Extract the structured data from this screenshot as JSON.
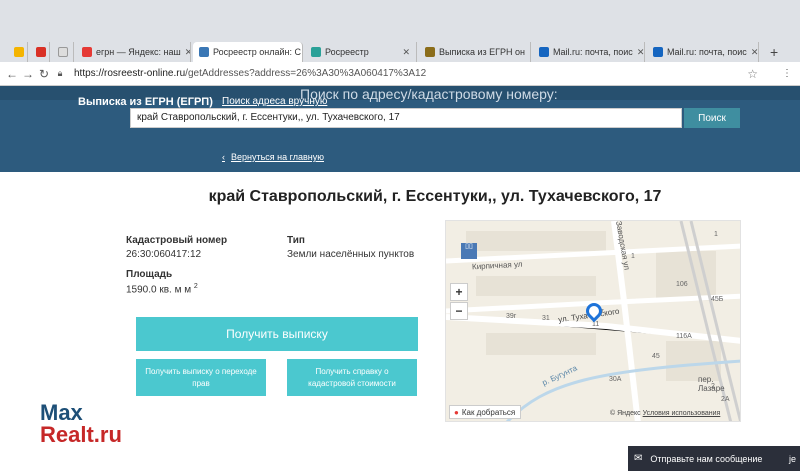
{
  "browser": {
    "tabs": [
      {
        "label": "",
        "color": "#f4b400"
      },
      {
        "label": "",
        "color": "#d93025"
      },
      {
        "label": "",
        "color": "#e8e8e8"
      },
      {
        "label": "егрн — Яндекс: наш",
        "color": "#e53935"
      },
      {
        "label": "Росреестр онлайн: С",
        "color": "#3a77b5"
      },
      {
        "label": "Росреестр",
        "color": "#2aa198"
      },
      {
        "label": "Выписка из ЕГРН он",
        "color": "#8b6d1a"
      },
      {
        "label": "Mail.ru: почта, поис",
        "color": "#1565c0"
      },
      {
        "label": "Mail.ru: почта, поис",
        "color": "#1565c0"
      }
    ],
    "new_tab": "+",
    "url_host": "https://rosreestr-online.ru",
    "url_path": "/getAddresses?address=26%3A30%3A060417%3A12"
  },
  "header": {
    "title": "Выписка из ЕГРН (ЕГРП)",
    "address_link": "Поиск адреса вручную",
    "search_caption": "Поиск по адресу/кадастровому номеру:",
    "search_value": "край Ставропольский, г. Ессентуки,, ул. Тухачевского, 17",
    "search_button": "Поиск",
    "back_link": "Вернуться на главную"
  },
  "property": {
    "address": "край Ставропольский, г. Ессентуки,, ул. Тухачевского, 17",
    "cadastral_label": "Кадастровый номер",
    "cadastral_value": "26:30:060417:12",
    "type_label": "Тип",
    "type_value": "Земли населённых пунктов",
    "area_label": "Площадь",
    "area_value": "1590.0 кв. м м",
    "area_sup": "2"
  },
  "actions": {
    "main": "Получить выписку",
    "transfer": "Получить выписку о переходе прав",
    "cadastral_value": "Получить справку о кадастровой стоимости"
  },
  "map": {
    "street_labels": [
      "Кирпичная ул",
      "ул. Тухачевского",
      "Заводская ул",
      "р. Бугунта",
      "пер. Лазаре"
    ],
    "house_numbers": [
      "39г",
      "31",
      "11",
      "17",
      "1",
      "30А",
      "106",
      "45Б",
      "116А",
      "2",
      "2А",
      "1",
      "45"
    ],
    "zoom_in": "+",
    "zoom_out": "−",
    "route_button": "Как добраться",
    "copyright": "© Яндекс",
    "terms": "Условия использования"
  },
  "watermark": {
    "line1": "Max",
    "line2": "Realt.ru"
  },
  "chat": {
    "label": "Отправьте нам сообщение",
    "extra": "je"
  }
}
